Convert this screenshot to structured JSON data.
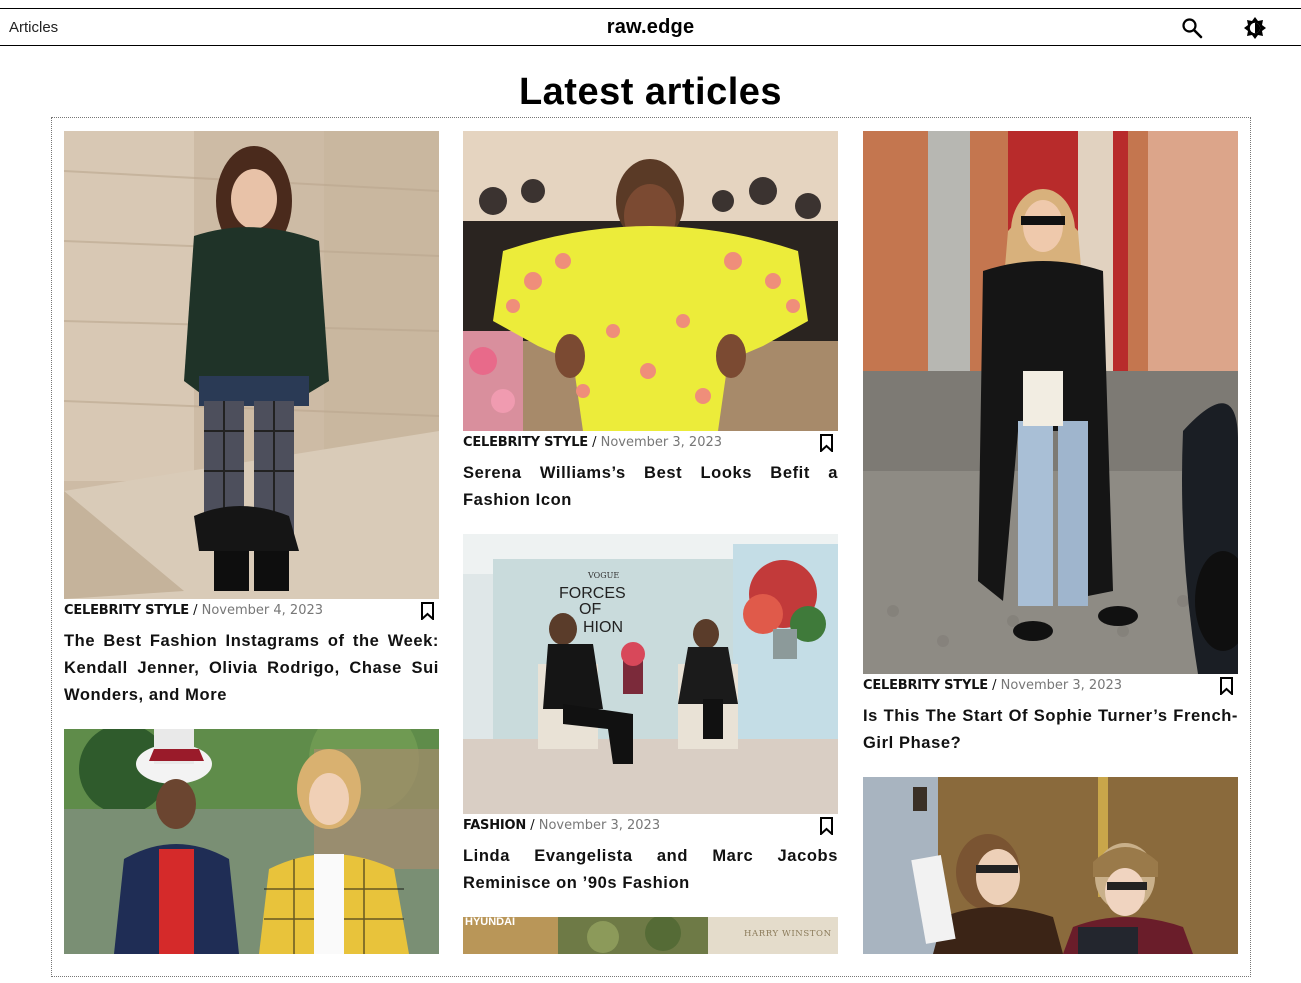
{
  "header": {
    "nav_label": "Articles",
    "brand": "raw.edge",
    "search_icon": "search-icon",
    "theme_icon": "brightness-icon"
  },
  "page": {
    "title": "Latest articles"
  },
  "articles": [
    {
      "category": "CELEBRITY STYLE",
      "date": "November 4, 2023",
      "title": "The Best Fashion Instagrams of the Week: Kendall Jenner, Olivia Rodrigo, Chase Sui Wonders, and More"
    },
    {
      "category": "CELEBRITY STYLE",
      "date": "November 3, 2023",
      "title": "Serena Williams’s Best Looks Befit a Fashion Icon"
    },
    {
      "category": "CELEBRITY STYLE",
      "date": "November 3, 2023",
      "title": "Is This The Start Of Sophie Turner’s French-Girl Phase?"
    },
    {
      "category": "FASHION",
      "date": "November 3, 2023",
      "title": "Linda Evangelista and Marc Jacobs Reminisce on ’90s Fashion"
    },
    {
      "category": "",
      "date": "",
      "title": ""
    },
    {
      "category": "",
      "date": "",
      "title": ""
    },
    {
      "category": "",
      "date": "",
      "title": ""
    }
  ],
  "image_text": {
    "vogue": "VOGUE",
    "forces_1": "FORCES",
    "forces_2": "OF",
    "forces_3": "HION",
    "hyundai": "HYUNDAI",
    "harry_winston": "HARRY WINSTON"
  },
  "colors": {
    "accent": "#000000",
    "date_text": "#777777",
    "frame_border": "#777777"
  },
  "separator": " / "
}
